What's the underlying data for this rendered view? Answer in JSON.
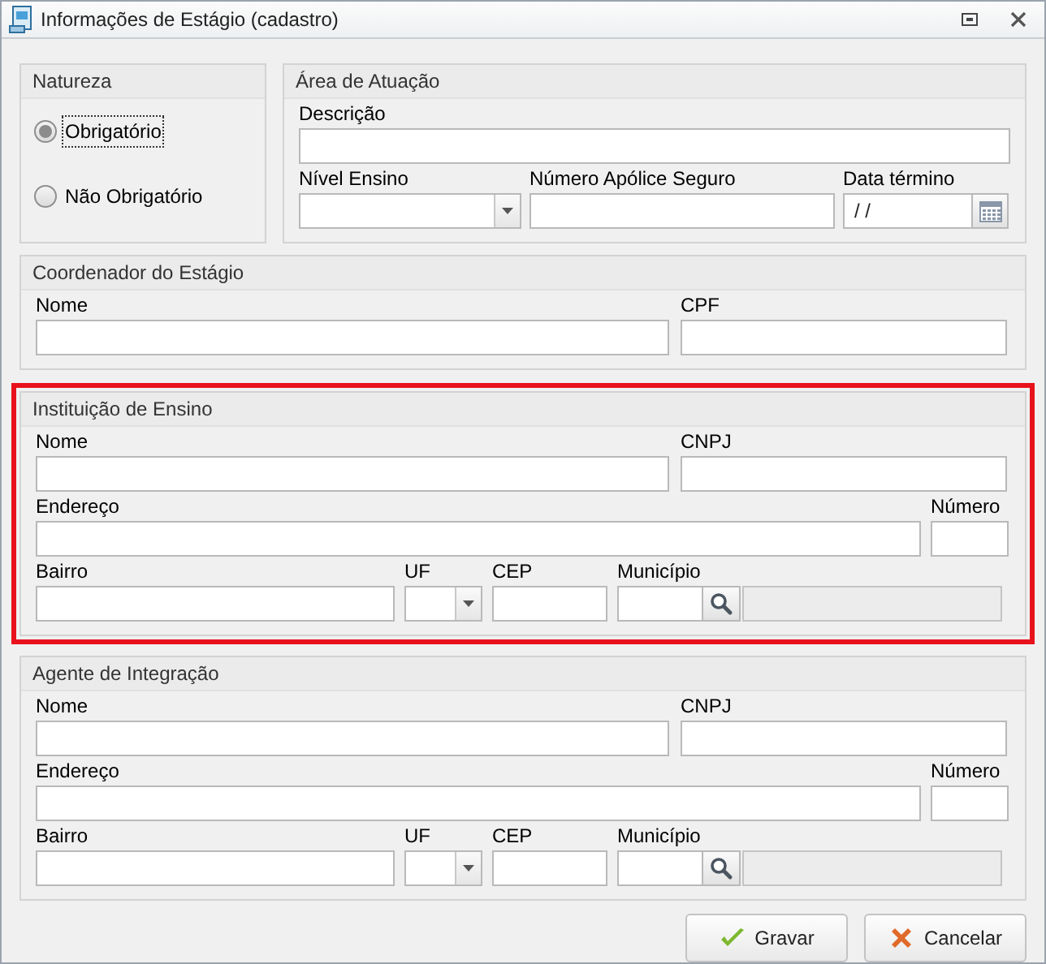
{
  "window": {
    "title": "Informações de Estágio (cadastro)"
  },
  "natureza": {
    "title": "Natureza",
    "options": [
      {
        "label": "Obrigatório",
        "selected": true
      },
      {
        "label": "Não Obrigatório",
        "selected": false
      }
    ]
  },
  "groups": [
    {
      "title": "Área de Atuação",
      "highlighted": false,
      "rows": [
        [
          {
            "label": "Descrição",
            "kind": "text"
          }
        ],
        [
          {
            "label": "Nível Ensino",
            "kind": "combo"
          },
          {
            "label": "Número Apólice Seguro",
            "kind": "text"
          },
          {
            "label": "Data término",
            "kind": "date",
            "value": "/ /"
          }
        ]
      ]
    },
    {
      "title": "Coordenador do Estágio",
      "highlighted": false,
      "rows": [
        [
          {
            "label": "Nome",
            "kind": "text"
          },
          {
            "label": "CPF",
            "kind": "text"
          }
        ]
      ]
    },
    {
      "title": "Instituição de Ensino",
      "highlighted": true,
      "rows": [
        [
          {
            "label": "Nome",
            "kind": "text"
          },
          {
            "label": "CNPJ",
            "kind": "text"
          }
        ],
        [
          {
            "label": "Endereço",
            "kind": "text"
          },
          {
            "label": "Número",
            "kind": "text"
          }
        ],
        [
          {
            "label": "Bairro",
            "kind": "text"
          },
          {
            "label": "UF",
            "kind": "combo"
          },
          {
            "label": "CEP",
            "kind": "text"
          },
          {
            "label": "Município",
            "kind": "lookup"
          }
        ]
      ]
    },
    {
      "title": "Agente de Integração",
      "highlighted": false,
      "rows": [
        [
          {
            "label": "Nome",
            "kind": "text"
          },
          {
            "label": "CNPJ",
            "kind": "text"
          }
        ],
        [
          {
            "label": "Endereço",
            "kind": "text"
          },
          {
            "label": "Número",
            "kind": "text"
          }
        ],
        [
          {
            "label": "Bairro",
            "kind": "text"
          },
          {
            "label": "UF",
            "kind": "combo"
          },
          {
            "label": "CEP",
            "kind": "text"
          },
          {
            "label": "Município",
            "kind": "lookup"
          }
        ]
      ]
    }
  ],
  "buttons": [
    {
      "label": "Gravar",
      "kind": "save"
    },
    {
      "label": "Cancelar",
      "kind": "cancel"
    }
  ]
}
